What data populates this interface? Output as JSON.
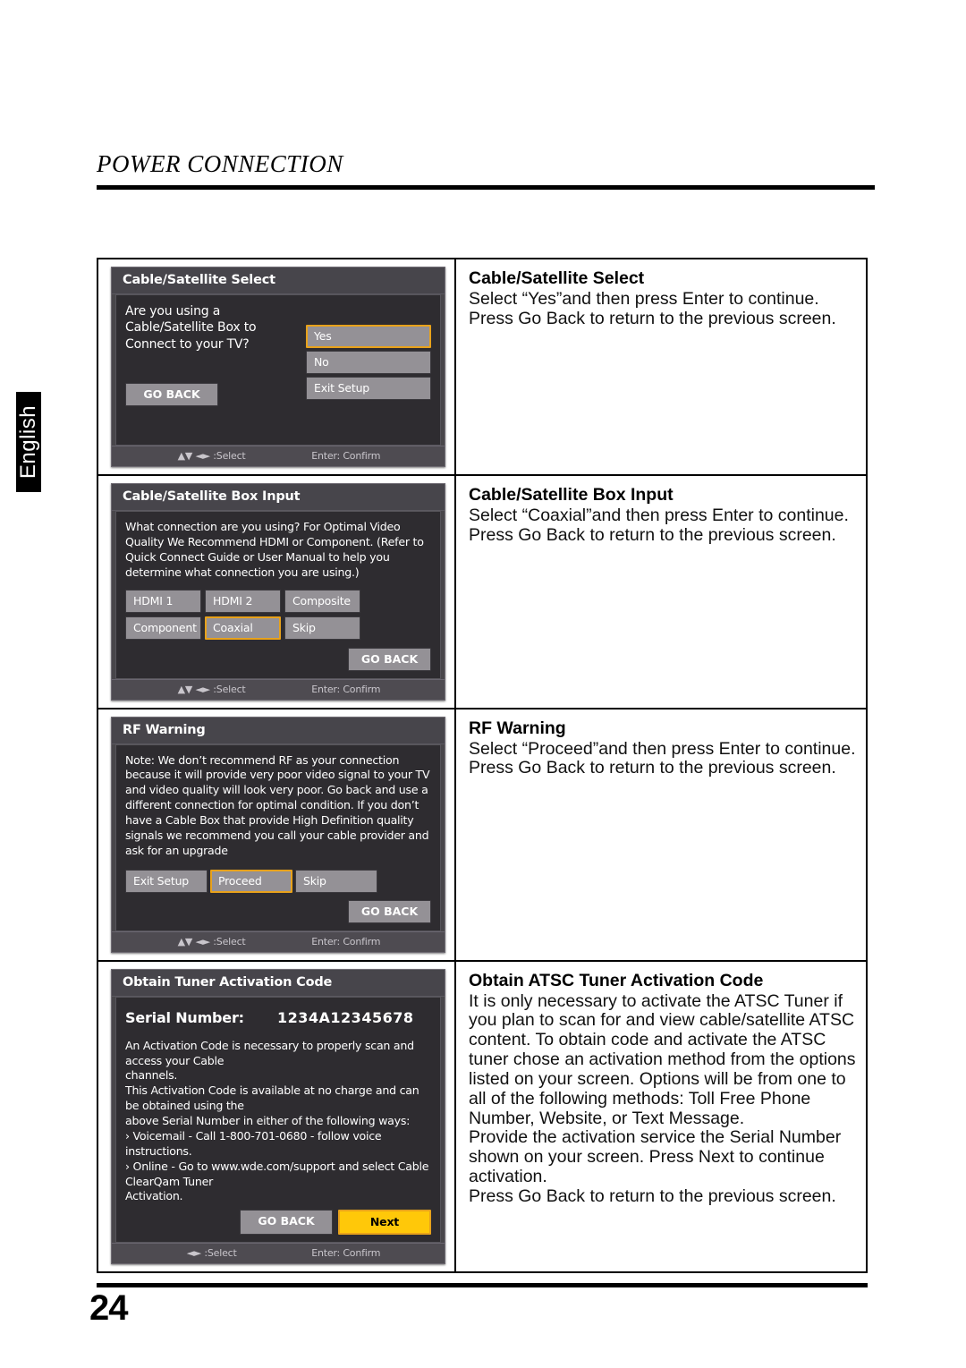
{
  "header": {
    "section_title": "POWER CONNECTION"
  },
  "language_tab": {
    "label": "English"
  },
  "footer": {
    "page_number": "24"
  },
  "osd_common": {
    "nav_hint": "▲▼ ◄► :Select",
    "nav_hint_lr": "◄► :Select",
    "enter_hint": "Enter: Confirm",
    "go_back": "GO BACK"
  },
  "rows": [
    {
      "panel": {
        "title": "Cable/Satellite Select",
        "question": "Are you using a\nCable/Satellite Box to\nConnect to your TV?",
        "options": [
          {
            "label": "Yes",
            "selected": true
          },
          {
            "label": "No",
            "selected": false
          },
          {
            "label": "Exit Setup",
            "selected": false
          }
        ],
        "go_back": "GO BACK",
        "nav_hint": "▲▼ ◄► :Select",
        "enter_hint": "Enter: Confirm"
      },
      "desc": {
        "title": "Cable/Satellite Select",
        "body": "Select “Yes”and then press Enter to continue.\nPress Go Back to return to the previous screen."
      }
    },
    {
      "panel": {
        "title": "Cable/Satellite Box Input",
        "question": "What connection are you using? For Optimal Video Quality We Recommend HDMI or Component. (Refer to Quick Connect Guide or User Manual to help you determine what connection you are using.)",
        "options": [
          {
            "label": "HDMI 1",
            "selected": false
          },
          {
            "label": "HDMI 2",
            "selected": false
          },
          {
            "label": "Composite",
            "selected": false
          },
          {
            "label": "Component",
            "selected": false
          },
          {
            "label": "Coaxial",
            "selected": true
          },
          {
            "label": "Skip",
            "selected": false
          }
        ],
        "go_back": "GO BACK",
        "nav_hint": "▲▼ ◄► :Select",
        "enter_hint": "Enter: Confirm"
      },
      "desc": {
        "title": "Cable/Satellite Box Input",
        "body": "Select “Coaxial”and then press Enter to continue.\nPress Go Back to return to the previous screen."
      }
    },
    {
      "panel": {
        "title": "RF Warning",
        "question": "Note: We don’t recommend RF as your connection because it will provide very poor video signal to your TV and video quality will look very poor. Go back and use a different connection for optimal condition. If you don’t have a Cable Box that provide High Definition quality signals we recommend you call your cable provider and ask for an upgrade",
        "options": [
          {
            "label": "Exit Setup",
            "selected": false
          },
          {
            "label": "Proceed",
            "selected": true
          },
          {
            "label": "Skip",
            "selected": false
          }
        ],
        "go_back": "GO BACK",
        "nav_hint": "▲▼ ◄► :Select",
        "enter_hint": "Enter: Confirm"
      },
      "desc": {
        "title": "RF Warning",
        "body": "Select “Proceed”and then press Enter to continue.\nPress Go Back to return to the previous screen."
      }
    },
    {
      "panel": {
        "title": "Obtain Tuner Activation Code",
        "serial_label": "Serial Number:",
        "serial_value": "1234A12345678",
        "info_lines": [
          "An Activation Code is necessary to properly scan and access your Cable",
          "channels.",
          "This Activation Code is available at no charge and can be obtained using the",
          "above Serial Number in either of the following ways:",
          "  › Voicemail - Call 1-800-701-0680 - follow voice instructions.",
          "  › Online - Go to www.wde.com/support and select Cable ClearQam Tuner",
          "     Activation."
        ],
        "go_back": "GO BACK",
        "next": "Next",
        "nav_hint": "◄► :Select",
        "enter_hint": "Enter: Confirm"
      },
      "desc": {
        "title": "Obtain ATSC Tuner Activation Code",
        "body": "It is only necessary to activate the ATSC Tuner if you plan to scan for and view cable/satellite ATSC content. To obtain code and activate the ATSC tuner chose an activation method from the options listed on your screen. Options will be from one to all of the following methods: Toll Free Phone Number, Website, or Text Message.\nProvide the activation service the Serial Number shown on your screen. Press Next to continue activation.\nPress Go Back to return to the previous screen."
      }
    }
  ],
  "colors": {
    "highlight": "#e8a21b",
    "next_button": "#ffc809",
    "panel_bg": "#2e2c30",
    "panel_header": "#47454b",
    "button_gray": "#949196"
  }
}
